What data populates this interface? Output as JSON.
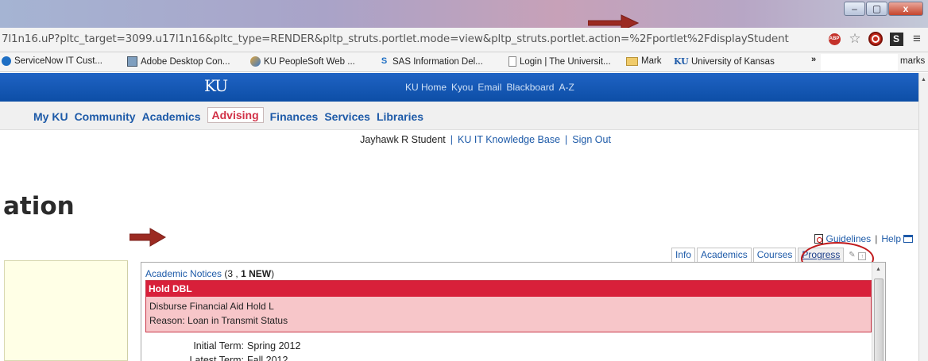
{
  "browser": {
    "url": "7l1n16.uP?pltc_target=3099.u17l1n16&pltc_type=RENDER&pltp_struts.portlet.mode=view&pltp_struts.portlet.action=%2Fportlet%2FdisplayStudent",
    "window_controls": [
      "–",
      "▢",
      "x"
    ],
    "adblock_label": "ABP",
    "s_label": "S",
    "menu_glyph": "≡",
    "star_glyph": "☆"
  },
  "bookmarks": [
    {
      "label": "ServiceNow IT Cust...",
      "icon": "servicenow-icon"
    },
    {
      "label": "Adobe Desktop Con...",
      "icon": "adobe-icon"
    },
    {
      "label": "KU PeopleSoft Web ...",
      "icon": "peoplesoft-icon"
    },
    {
      "label": "SAS Information Del...",
      "icon": "sas-icon"
    },
    {
      "label": "Login | The Universit...",
      "icon": "page-icon"
    },
    {
      "label": "Mark",
      "icon": "folder-icon"
    },
    {
      "label": "University of Kansas",
      "icon": "ku-icon",
      "icon_text": "KU"
    }
  ],
  "bookmarks_more": "»",
  "bookmarks_tail": "marks",
  "ku_header": {
    "logo": "KU",
    "links": [
      "KU Home",
      "Kyou",
      "Email",
      "Blackboard",
      "A-Z"
    ]
  },
  "main_nav": [
    "My KU",
    "Community",
    "Academics",
    "Advising",
    "Finances",
    "Services",
    "Libraries"
  ],
  "active_nav": "Advising",
  "user_bar": {
    "name": "Jayhawk R Student",
    "separator": "|",
    "links": [
      "KU IT Knowledge Base",
      "Sign Out"
    ]
  },
  "page_heading": "ation",
  "help_row": {
    "guidelines": "Guidelines",
    "separator": "|",
    "help": "Help"
  },
  "tabs": [
    "Info",
    "Academics",
    "Courses",
    "Progress"
  ],
  "notices": {
    "title_link": "Academic Notices",
    "count_prefix": " (3 , ",
    "count_new": "1 NEW",
    "count_suffix": ")",
    "hold_title": "Hold DBL",
    "hold_line1": "Disburse Financial Aid Hold L",
    "hold_line2": "Reason: Loan in Transmit Status",
    "terms": [
      {
        "label": "Initial Term:",
        "value": "Spring 2012"
      },
      {
        "label": "Latest Term:",
        "value": "Fall 2012"
      }
    ]
  },
  "colors": {
    "ku_blue": "#1659b8",
    "nav_link": "#1d5aa8",
    "active_nav": "#d13147",
    "hold_red": "#d8203a",
    "hold_pink": "#f7c6c9",
    "annotation_red": "#c0191b",
    "arrow_red": "#9b2a22"
  }
}
